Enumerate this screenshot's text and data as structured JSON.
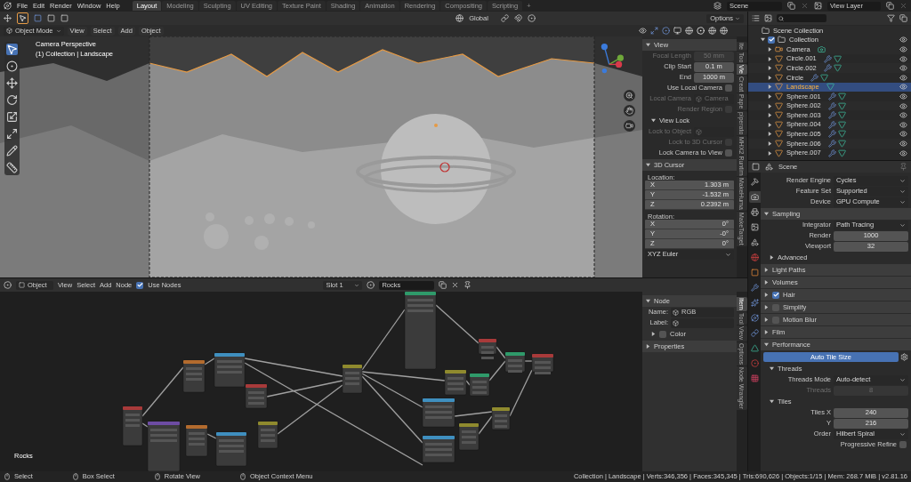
{
  "topbar": {
    "menus": [
      "File",
      "Edit",
      "Render",
      "Window",
      "Help"
    ],
    "workspaces": [
      {
        "label": "Layout",
        "selected": true
      },
      {
        "label": "Modeling",
        "selected": false
      },
      {
        "label": "Sculpting",
        "selected": false
      },
      {
        "label": "UV Editing",
        "selected": false
      },
      {
        "label": "Texture Paint",
        "selected": false
      },
      {
        "label": "Shading",
        "selected": false
      },
      {
        "label": "Animation",
        "selected": false
      },
      {
        "label": "Rendering",
        "selected": false
      },
      {
        "label": "Compositing",
        "selected": false
      },
      {
        "label": "Scripting",
        "selected": false
      }
    ],
    "add_tab": "+",
    "scene": "Scene",
    "view_layer": "View Layer"
  },
  "tool_header": {
    "orientation": "Global",
    "options": "Options"
  },
  "viewport": {
    "mode": "Object Mode",
    "menus": [
      "View",
      "Select",
      "Add",
      "Object"
    ],
    "overlay_lines": [
      "Camera Perspective",
      "(1) Collection | Landscape"
    ],
    "sidebar": [
      {
        "kind": "panel",
        "label": "View",
        "expanded": true
      },
      {
        "kind": "field",
        "label": "Focal Length",
        "value": "50 mm",
        "disabled": true
      },
      {
        "kind": "field",
        "label": "Clip Start",
        "value": "0.1 m",
        "disabled": false
      },
      {
        "kind": "field",
        "label": "End",
        "value": "1000 m",
        "disabled": false
      },
      {
        "kind": "checkbox",
        "label": "Use Local Camera",
        "checked": false,
        "disabled": false
      },
      {
        "kind": "object",
        "label": "Local Camera",
        "value": "Camera",
        "disabled": true
      },
      {
        "kind": "checkbox",
        "label": "Render Region",
        "checked": false,
        "disabled": true
      },
      {
        "kind": "subpanel",
        "label": "View Lock",
        "expanded": true
      },
      {
        "kind": "object",
        "label": "Lock to Object",
        "disabled": true
      },
      {
        "kind": "checkbox",
        "label": "Lock to 3D Cursor",
        "checked": false,
        "disabled": true
      },
      {
        "kind": "checkbox",
        "label": "Lock Camera to View",
        "checked": false,
        "disabled": false
      },
      {
        "kind": "panel",
        "label": "3D Cursor",
        "expanded": true
      },
      {
        "kind": "label",
        "label": "Location:"
      },
      {
        "kind": "vector",
        "axis": "X",
        "value": "1.303 m"
      },
      {
        "kind": "vector",
        "axis": "Y",
        "value": "-1.532 m"
      },
      {
        "kind": "vector",
        "axis": "Z",
        "value": "0.2392 m"
      },
      {
        "kind": "label",
        "label": "Rotation:"
      },
      {
        "kind": "vector",
        "axis": "X",
        "value": "0°"
      },
      {
        "kind": "vector",
        "axis": "Y",
        "value": "-0°"
      },
      {
        "kind": "vector",
        "axis": "Z",
        "value": "0°"
      },
      {
        "kind": "dropdown",
        "value": "XYZ Euler"
      }
    ],
    "tabs": [
      {
        "label": "Ite",
        "selected": false
      },
      {
        "label": "Too",
        "selected": false
      },
      {
        "label": "Vie",
        "selected": true
      },
      {
        "label": "Creat",
        "selected": false
      },
      {
        "label": "Pape",
        "selected": false
      },
      {
        "label": "piperato",
        "selected": false
      },
      {
        "label": "MHX2 Runtim",
        "selected": false
      },
      {
        "label": "MakeHuma",
        "selected": false
      },
      {
        "label": "MakeTarget",
        "selected": false
      }
    ]
  },
  "outliner": {
    "tree": [
      {
        "label": "Scene Collection",
        "children": [
          {
            "label": "Collection",
            "checked": true,
            "children": [
              {
                "label": "Camera",
                "kind": "camera",
                "modifier": false,
                "selected": false
              },
              {
                "label": "Circle.001",
                "kind": "mesh",
                "modifier": true,
                "selected": false
              },
              {
                "label": "Circle.002",
                "kind": "mesh",
                "modifier": true,
                "selected": false
              },
              {
                "label": "Circle",
                "kind": "mesh",
                "modifier": true,
                "selected": false
              },
              {
                "label": "Landscape",
                "kind": "mesh",
                "modifier": false,
                "selected": true
              },
              {
                "label": "Sphere.001",
                "kind": "mesh",
                "modifier": true,
                "selected": false
              },
              {
                "label": "Sphere.002",
                "kind": "mesh",
                "modifier": true,
                "selected": false
              },
              {
                "label": "Sphere.003",
                "kind": "mesh",
                "modifier": true,
                "selected": false
              },
              {
                "label": "Sphere.004",
                "kind": "mesh",
                "modifier": true,
                "selected": false
              },
              {
                "label": "Sphere.005",
                "kind": "mesh",
                "modifier": true,
                "selected": false
              },
              {
                "label": "Sphere.006",
                "kind": "mesh",
                "modifier": true,
                "selected": false
              },
              {
                "label": "Sphere.007",
                "kind": "mesh",
                "modifier": true,
                "selected": false
              }
            ]
          }
        ]
      }
    ]
  },
  "properties": {
    "context": "Scene",
    "tabs": [
      {
        "selected": false
      },
      {
        "selected": true
      },
      {
        "selected": false
      },
      {
        "selected": false
      },
      {
        "selected": false
      },
      {
        "selected": false
      },
      {
        "selected": false
      },
      {
        "selected": false
      },
      {
        "selected": false
      },
      {
        "selected": false
      },
      {
        "selected": false
      },
      {
        "selected": false
      },
      {
        "selected": false
      },
      {
        "selected": false
      }
    ],
    "rows": [
      {
        "kind": "dropdown",
        "label": "Render Engine",
        "value": "Cycles"
      },
      {
        "kind": "dropdown",
        "label": "Feature Set",
        "value": "Supported"
      },
      {
        "kind": "dropdown",
        "label": "Device",
        "value": "GPU Compute"
      },
      {
        "kind": "panel",
        "label": "Sampling",
        "expanded": true
      },
      {
        "kind": "dropdown",
        "label": "Integrator",
        "value": "Path Tracing"
      },
      {
        "kind": "field",
        "label": "Render",
        "value": "1000",
        "disabled": false
      },
      {
        "kind": "field",
        "label": "Viewport",
        "value": "32",
        "disabled": false
      },
      {
        "kind": "subpanel",
        "label": "Advanced",
        "expanded": false
      },
      {
        "kind": "panel",
        "label": "Light Paths",
        "expanded": false
      },
      {
        "kind": "panel",
        "label": "Volumes",
        "expanded": false
      },
      {
        "kind": "panel",
        "label": "Hair",
        "expanded": false,
        "checked": true
      },
      {
        "kind": "panel",
        "label": "Simplify",
        "expanded": false,
        "checked": false
      },
      {
        "kind": "panel",
        "label": "Motion Blur",
        "expanded": false,
        "checked": false
      },
      {
        "kind": "panel",
        "label": "Film",
        "expanded": false
      },
      {
        "kind": "panel",
        "label": "Performance",
        "expanded": true
      },
      {
        "kind": "button",
        "label": "Auto Tile Size"
      },
      {
        "kind": "subpanel",
        "label": "Threads",
        "expanded": true
      },
      {
        "kind": "dropdown",
        "label": "Threads Mode",
        "value": "Auto-detect"
      },
      {
        "kind": "field",
        "label": "Threads",
        "value": "8",
        "disabled": true
      },
      {
        "kind": "subpanel",
        "label": "Tiles",
        "expanded": true
      },
      {
        "kind": "field",
        "label": "Tiles X",
        "value": "240",
        "disabled": false
      },
      {
        "kind": "field",
        "label": "Y",
        "value": "216",
        "disabled": false
      },
      {
        "kind": "dropdown",
        "label": "Order",
        "value": "Hilbert Spiral"
      },
      {
        "kind": "checkbox",
        "label": "Progressive Refine",
        "checked": false,
        "disabled": false
      }
    ]
  },
  "node_editor": {
    "object": "Object",
    "menus": [
      "View",
      "Select",
      "Add",
      "Node"
    ],
    "use_nodes": {
      "label": "Use Nodes",
      "checked": true
    },
    "slot": "Slot 1",
    "material": "Rocks",
    "canvas_label": "Rocks",
    "sidebar": [
      {
        "kind": "panel",
        "label": "Node",
        "expanded": true
      },
      {
        "kind": "object",
        "label": "Name:",
        "value": "RGB",
        "disabled": false
      },
      {
        "kind": "object",
        "label": "Label:",
        "disabled": false
      },
      {
        "kind": "subpanel",
        "label": "Color",
        "expanded": false,
        "checked": false
      },
      {
        "kind": "panel",
        "label": "Properties",
        "expanded": false
      }
    ],
    "tabs": [
      {
        "label": "Item",
        "selected": true
      },
      {
        "label": "Tool",
        "selected": false
      },
      {
        "label": "View",
        "selected": false
      },
      {
        "label": "Options",
        "selected": false
      },
      {
        "label": "Node Wrangler",
        "selected": false
      }
    ]
  },
  "status_bar": {
    "hints": [
      "Select",
      "Box Select",
      "Rotate View",
      "Object Context Menu"
    ],
    "stats": "Collection | Landscape | Verts:346,356 | Faces:345,345 | Tris:690,626 | Objects:1/15 | Mem: 268.7 MiB | v2.81.16"
  }
}
